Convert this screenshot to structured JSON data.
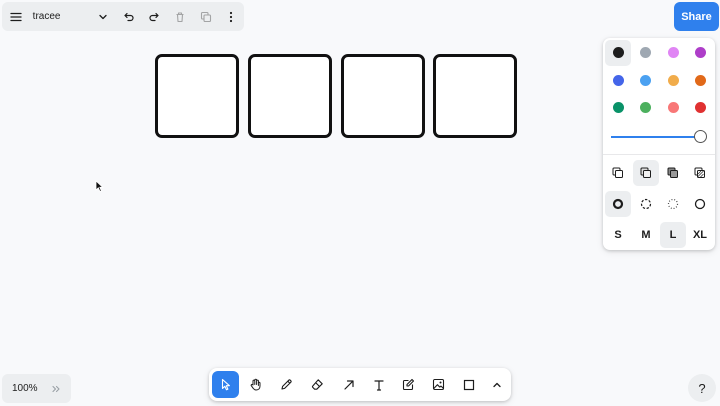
{
  "menu": {
    "page_name": "tracee",
    "icons": [
      "menu-icon",
      "chevron-down-icon",
      "undo-icon",
      "redo-icon",
      "trash-icon",
      "duplicate-icon",
      "more-vertical-icon"
    ]
  },
  "share": {
    "label": "Share",
    "color": "#2f80ed"
  },
  "canvas": {
    "shapes": [
      "rectangle",
      "rectangle",
      "rectangle",
      "rectangle"
    ],
    "stroke_color": "#111111"
  },
  "style_panel": {
    "colors": [
      "#1d1d1d",
      "#9fa8b2",
      "#e085f4",
      "#ae3ec9",
      "#4465e9",
      "#4ba1f1",
      "#f1ac4b",
      "#e16919",
      "#099268",
      "#4cb05e",
      "#f87777",
      "#e03131"
    ],
    "selected_color": "#1d1d1d",
    "opacity": 1.0,
    "fill_icons": [
      "fill-none-icon",
      "fill-semi-icon",
      "fill-solid-icon",
      "fill-pattern-icon"
    ],
    "selected_fill": "fill-semi-icon",
    "dash_icons": [
      "dash-draw-icon",
      "dash-dashed-icon",
      "dash-dotted-icon",
      "dash-solid-icon"
    ],
    "selected_dash": "dash-draw-icon",
    "sizes": [
      "S",
      "M",
      "L",
      "XL"
    ],
    "selected_size": "L"
  },
  "toolbar": {
    "tools": [
      "select-icon",
      "hand-icon",
      "pencil-icon",
      "eraser-icon",
      "arrow-icon",
      "text-icon",
      "note-icon",
      "image-icon",
      "rectangle-icon",
      "chevron-up-icon"
    ],
    "selected_tool": "select-icon"
  },
  "zoom": {
    "label": "100%"
  },
  "help": {
    "label": "?"
  }
}
